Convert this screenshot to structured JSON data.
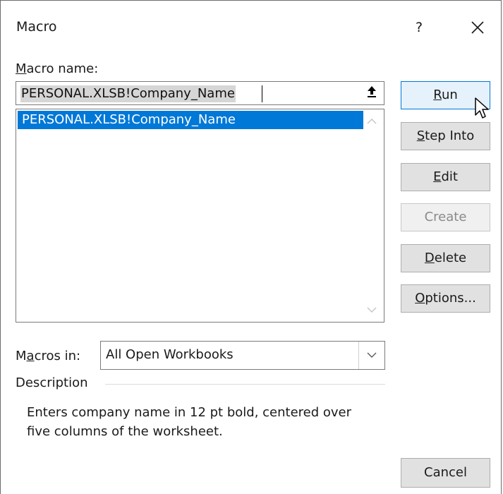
{
  "dialog": {
    "title": "Macro",
    "help_label": "?"
  },
  "macro_name": {
    "label_underlined": "M",
    "label_rest": "acro name:",
    "value": "PERSONAL.XLSB!Company_Name"
  },
  "macro_list": {
    "items": [
      "PERSONAL.XLSB!Company_Name"
    ],
    "selected_index": 0
  },
  "buttons": {
    "run": {
      "underlined": "R",
      "rest": "un"
    },
    "step_into": {
      "underlined": "S",
      "rest": "tep Into"
    },
    "edit": {
      "underlined": "E",
      "rest": "dit"
    },
    "create": {
      "label": "Create"
    },
    "delete": {
      "underlined": "D",
      "rest": "elete"
    },
    "options": {
      "underlined": "O",
      "rest": "ptions..."
    },
    "cancel": {
      "label": "Cancel"
    }
  },
  "macros_in": {
    "label_pre": "M",
    "label_underlined": "a",
    "label_rest": "cros in:",
    "selected": "All Open Workbooks"
  },
  "description": {
    "heading": "Description",
    "line1": "Enters company name in 12 pt bold, centered over",
    "line2": "five columns of the worksheet."
  },
  "colors": {
    "selection": "#0078d7",
    "default_button_bg": "#e5f1fb",
    "button_bg": "#e1e1e1"
  },
  "icons": {
    "collapse": "up-arrow-icon",
    "close": "close-icon",
    "dropdown": "chevron-down-icon",
    "cursor": "mouse-pointer-icon"
  }
}
